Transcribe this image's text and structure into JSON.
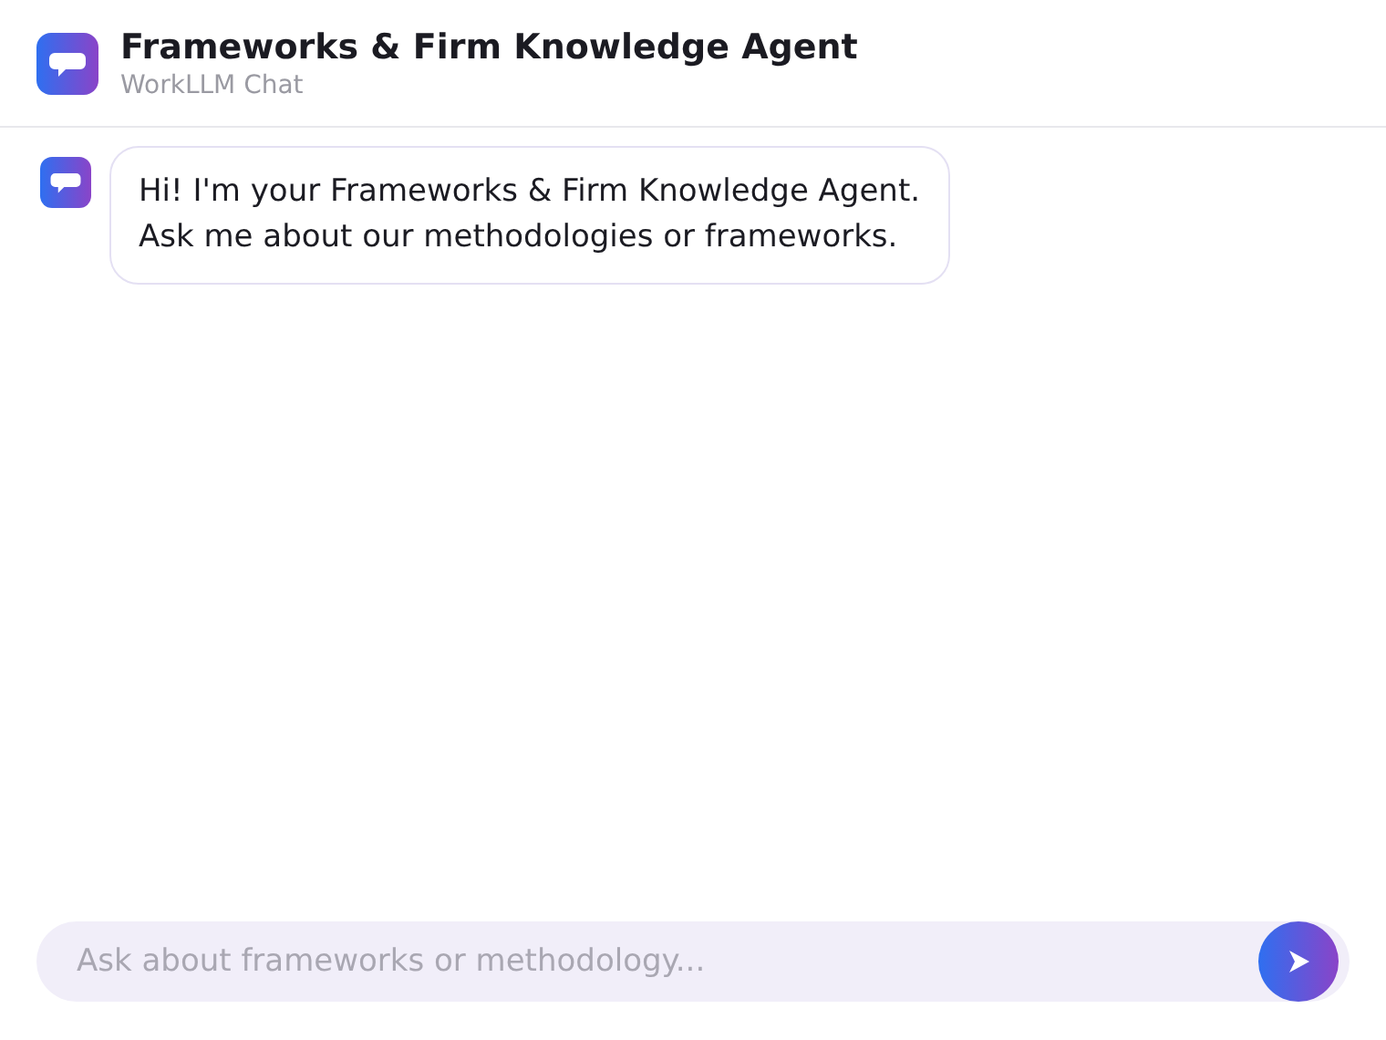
{
  "header": {
    "title": "Frameworks & Firm Knowledge Agent",
    "subtitle": "WorkLLM Chat"
  },
  "messages": [
    {
      "kind": "agent",
      "text": "Hi! I'm your Frameworks & Firm Knowledge Agent.\nAsk me about our methodologies or frameworks."
    }
  ],
  "composer": {
    "placeholder": "Ask about frameworks or methodology..."
  }
}
